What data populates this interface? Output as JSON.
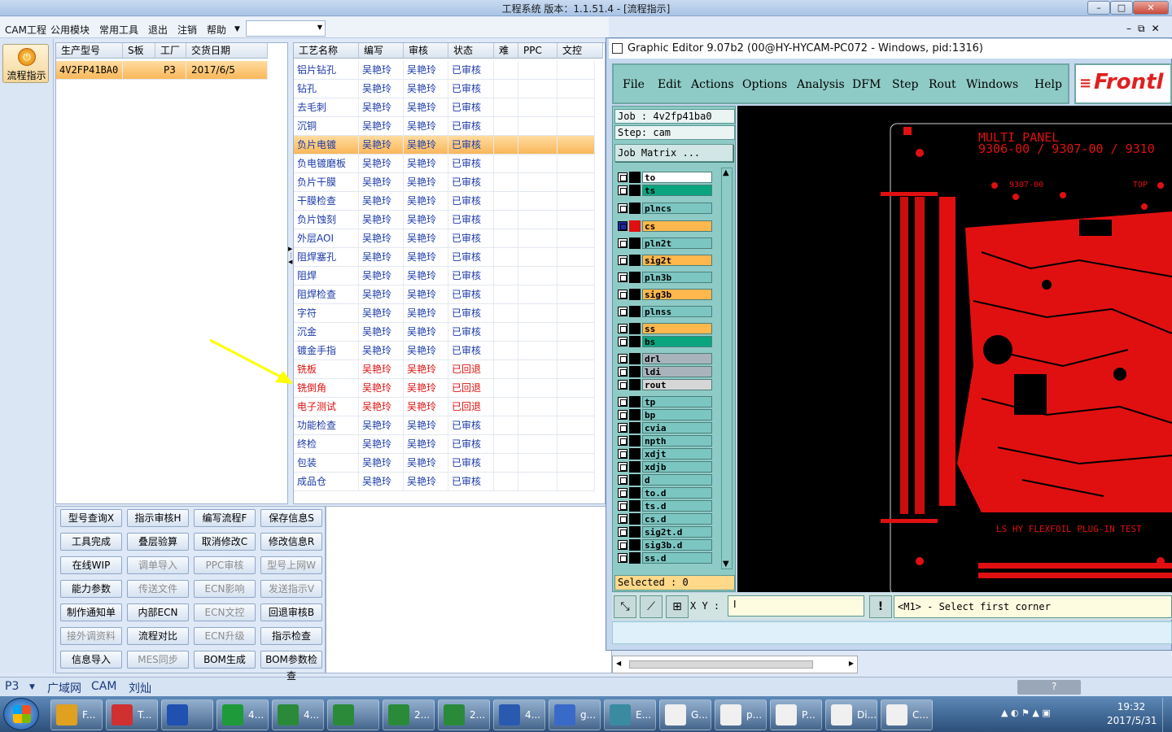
{
  "window": {
    "title": "工程系统    版本：1.1.51.4 - [流程指示]"
  },
  "menu": [
    "CAM工程",
    "公用模块",
    "常用工具",
    "退出",
    "注销",
    "帮助"
  ],
  "left_nav": {
    "flow_button": "流程指示"
  },
  "product_grid": {
    "headers": [
      "生产型号",
      "S板",
      "工厂",
      "交货日期"
    ],
    "rows": [
      [
        "4V2FP41BA0",
        "",
        "P3",
        "2017/6/5"
      ]
    ]
  },
  "process_grid": {
    "headers": [
      "工艺名称",
      "编写",
      "审核",
      "状态",
      "难",
      "PPC",
      "文控"
    ],
    "rows": [
      {
        "name": "铝片钻孔",
        "writer": "吴艳玲",
        "reviewer": "吴艳玲",
        "status": "已审核",
        "red": false
      },
      {
        "name": "钻孔",
        "writer": "吴艳玲",
        "reviewer": "吴艳玲",
        "status": "已审核",
        "red": false
      },
      {
        "name": "去毛刺",
        "writer": "吴艳玲",
        "reviewer": "吴艳玲",
        "status": "已审核",
        "red": false
      },
      {
        "name": "沉铜",
        "writer": "吴艳玲",
        "reviewer": "吴艳玲",
        "status": "已审核",
        "red": false
      },
      {
        "name": "负片电镀",
        "writer": "吴艳玲",
        "reviewer": "吴艳玲",
        "status": "已审核",
        "red": false
      },
      {
        "name": "负电镀磨板",
        "writer": "吴艳玲",
        "reviewer": "吴艳玲",
        "status": "已审核",
        "red": false
      },
      {
        "name": "负片干膜",
        "writer": "吴艳玲",
        "reviewer": "吴艳玲",
        "status": "已审核",
        "red": false
      },
      {
        "name": "干膜检查",
        "writer": "吴艳玲",
        "reviewer": "吴艳玲",
        "status": "已审核",
        "red": false
      },
      {
        "name": "负片蚀刻",
        "writer": "吴艳玲",
        "reviewer": "吴艳玲",
        "status": "已审核",
        "red": false
      },
      {
        "name": "外层AOI",
        "writer": "吴艳玲",
        "reviewer": "吴艳玲",
        "status": "已审核",
        "red": false
      },
      {
        "name": "阻焊塞孔",
        "writer": "吴艳玲",
        "reviewer": "吴艳玲",
        "status": "已审核",
        "red": false
      },
      {
        "name": "阻焊",
        "writer": "吴艳玲",
        "reviewer": "吴艳玲",
        "status": "已审核",
        "red": false
      },
      {
        "name": "阻焊检查",
        "writer": "吴艳玲",
        "reviewer": "吴艳玲",
        "status": "已审核",
        "red": false
      },
      {
        "name": "字符",
        "writer": "吴艳玲",
        "reviewer": "吴艳玲",
        "status": "已审核",
        "red": false
      },
      {
        "name": "沉金",
        "writer": "吴艳玲",
        "reviewer": "吴艳玲",
        "status": "已审核",
        "red": false
      },
      {
        "name": "镀金手指",
        "writer": "吴艳玲",
        "reviewer": "吴艳玲",
        "status": "已审核",
        "red": false
      },
      {
        "name": "铣板",
        "writer": "吴艳玲",
        "reviewer": "吴艳玲",
        "status": "已回退",
        "red": true
      },
      {
        "name": "铣倒角",
        "writer": "吴艳玲",
        "reviewer": "吴艳玲",
        "status": "已回退",
        "red": true
      },
      {
        "name": "电子测试",
        "writer": "吴艳玲",
        "reviewer": "吴艳玲",
        "status": "已回退",
        "red": true
      },
      {
        "name": "功能检查",
        "writer": "吴艳玲",
        "reviewer": "吴艳玲",
        "status": "已审核",
        "red": false
      },
      {
        "name": "终检",
        "writer": "吴艳玲",
        "reviewer": "吴艳玲",
        "status": "已审核",
        "red": false
      },
      {
        "name": "包装",
        "writer": "吴艳玲",
        "reviewer": "吴艳玲",
        "status": "已审核",
        "red": false
      },
      {
        "name": "成品仓",
        "writer": "吴艳玲",
        "reviewer": "吴艳玲",
        "status": "已审核",
        "red": false
      }
    ]
  },
  "actions": [
    {
      "label": "型号查询X",
      "enabled": true
    },
    {
      "label": "指示审核H",
      "enabled": true
    },
    {
      "label": "编写流程F",
      "enabled": true
    },
    {
      "label": "保存信息S",
      "enabled": true
    },
    {
      "label": "工具完成",
      "enabled": true
    },
    {
      "label": "叠层验算",
      "enabled": true
    },
    {
      "label": "取消修改C",
      "enabled": true
    },
    {
      "label": "修改信息R",
      "enabled": true
    },
    {
      "label": "在线WIP",
      "enabled": true
    },
    {
      "label": "调单导入",
      "enabled": false
    },
    {
      "label": "PPC审核",
      "enabled": false
    },
    {
      "label": "型号上网W",
      "enabled": false
    },
    {
      "label": "能力参数",
      "enabled": true
    },
    {
      "label": "传送文件",
      "enabled": false
    },
    {
      "label": "ECN影响",
      "enabled": false
    },
    {
      "label": "发送指示V",
      "enabled": false
    },
    {
      "label": "制作通知单",
      "enabled": true
    },
    {
      "label": "内部ECN",
      "enabled": true
    },
    {
      "label": "ECN文控",
      "enabled": false
    },
    {
      "label": "回退审核B",
      "enabled": true
    },
    {
      "label": "接外调资料",
      "enabled": false
    },
    {
      "label": "流程对比",
      "enabled": true
    },
    {
      "label": "ECN升级",
      "enabled": false
    },
    {
      "label": "指示检查",
      "enabled": true
    },
    {
      "label": "信息导入",
      "enabled": true
    },
    {
      "label": "MES同步",
      "enabled": false
    },
    {
      "label": "BOM生成",
      "enabled": true
    },
    {
      "label": "BOM参数检查",
      "enabled": true
    }
  ],
  "graphic_editor": {
    "title": "Graphic Editor 9.07b2 (00@HY-HYCAM-PC072 - Windows, pid:1316)",
    "menu": [
      "File",
      "Edit",
      "Actions",
      "Options",
      "Analysis",
      "DFM",
      "Step",
      "Rout",
      "Windows",
      "Help"
    ],
    "logo": "Frontl",
    "job": "Job : 4v2fp41ba0",
    "step": "Step: cam",
    "job_matrix": "Job Matrix ...",
    "layers": [
      {
        "name": "to",
        "color": "#ffffff"
      },
      {
        "name": "ts",
        "color": "#0aa57e"
      },
      {
        "name": "plncs",
        "color": "#7cc6c2"
      },
      {
        "name": "cs",
        "color": "#ffb84d"
      },
      {
        "name": "pln2t",
        "color": "#7cc6c2"
      },
      {
        "name": "sig2t",
        "color": "#ffb84d"
      },
      {
        "name": "pln3b",
        "color": "#7cc6c2"
      },
      {
        "name": "sig3b",
        "color": "#ffb84d"
      },
      {
        "name": "plnss",
        "color": "#7cc6c2"
      },
      {
        "name": "ss",
        "color": "#ffb84d"
      },
      {
        "name": "bs",
        "color": "#0aa57e"
      },
      {
        "name": "drl",
        "color": "#a9b3bc"
      },
      {
        "name": "ldi",
        "color": "#a9b3bc"
      },
      {
        "name": "rout",
        "color": "#d6d6d6"
      },
      {
        "name": "tp",
        "color": "#7cc6c2"
      },
      {
        "name": "bp",
        "color": "#7cc6c2"
      },
      {
        "name": "cvia",
        "color": "#7cc6c2"
      },
      {
        "name": "npth",
        "color": "#7cc6c2"
      },
      {
        "name": "xdjt",
        "color": "#7cc6c2"
      },
      {
        "name": "xdjb",
        "color": "#7cc6c2"
      },
      {
        "name": "d",
        "color": "#7cc6c2"
      },
      {
        "name": "to.d",
        "color": "#7cc6c2"
      },
      {
        "name": "ts.d",
        "color": "#7cc6c2"
      },
      {
        "name": "cs.d",
        "color": "#7cc6c2"
      },
      {
        "name": "sig2t.d",
        "color": "#7cc6c2"
      },
      {
        "name": "sig3b.d",
        "color": "#7cc6c2"
      },
      {
        "name": "ss.d",
        "color": "#7cc6c2"
      }
    ],
    "selected": "Selected : 0",
    "xy_label": "X Y :",
    "message": "<M1> - Select first corner",
    "board_text": [
      "MULTI PANEL",
      "9306-00 / 9307-00 / 9310",
      "9307-00",
      "TOP",
      "LS HY FLEXFOIL PLUG-IN TEST"
    ]
  },
  "bottom_tabs": [
    "P3",
    "广域网",
    "CAM",
    "刘灿"
  ],
  "taskbar": {
    "items": [
      "F...",
      "T...",
      "",
      "4...",
      "4...",
      "",
      "2...",
      "2...",
      "4...",
      "g...",
      "E...",
      "G...",
      "p...",
      "P...",
      "Di...",
      "C..."
    ],
    "time": "19:32",
    "date": "2017/5/31"
  }
}
